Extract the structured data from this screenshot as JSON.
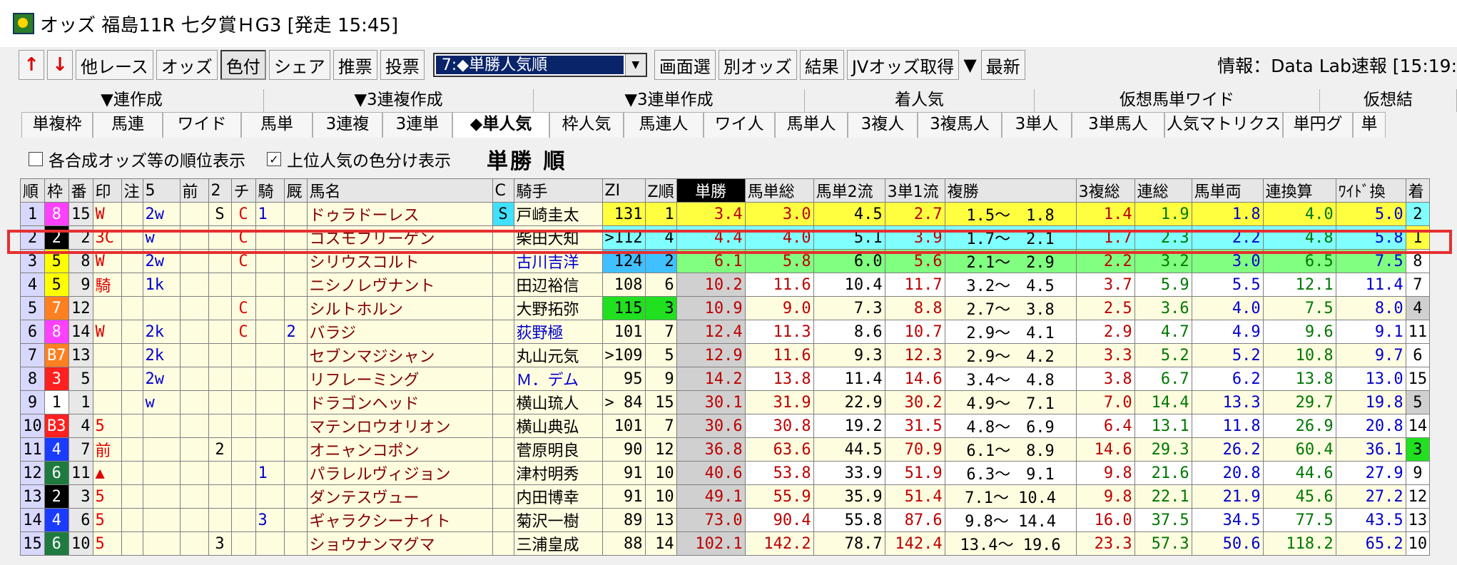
{
  "window": {
    "title": "オッズ 福島11R 七夕賞ＨG3 [発走 15:45]"
  },
  "toolbar": {
    "up_label": "↑",
    "down_label": "↓",
    "buttons": [
      "他レース",
      "オッズ",
      "色付",
      "シェア",
      "推票",
      "投票"
    ],
    "select_value": "7:◆単勝人気順",
    "buttons2": [
      "画面選",
      "別オッズ",
      "結果",
      "JVオッズ取得",
      "▼",
      "最新"
    ],
    "info": "情報：Data Lab速報 [15:19:"
  },
  "tabs_row1": [
    "▼連作成",
    "▼3連複作成",
    "▼3連単作成",
    "着人気",
    "仮想馬単ワイド",
    "仮想結"
  ],
  "tabs_row2": [
    "単複枠",
    "馬連",
    "ワイド",
    "馬単",
    "3連複",
    "3連単",
    "◆単人気",
    "枠人気",
    "馬連人",
    "ワイ人",
    "馬単人",
    "3複人",
    "3複馬人",
    "3単人",
    "3単馬人",
    "人気マトリクス",
    "単円グ",
    "単"
  ],
  "options": {
    "opt1": "各合成オッズ等の順位表示",
    "opt2": "上位人気の色分け表示",
    "heading": "単勝 順",
    "opt2_check": "✓"
  },
  "table": {
    "headers": [
      "順",
      "枠",
      "番",
      "印",
      "注",
      "5",
      "前",
      "2",
      "チ",
      "騎",
      "厩",
      "馬名",
      "C",
      "騎手",
      "ZI",
      "Z順",
      "単勝",
      "馬単総",
      "馬単2流",
      "3単1流",
      "複勝",
      "3複総",
      "連総",
      "馬単両",
      "連換算",
      "ﾜｲﾄﾞ換",
      "着"
    ],
    "rows": [
      [
        "1",
        "8",
        "15",
        "W",
        "",
        "2w",
        "",
        "S",
        "C",
        "1",
        "",
        "ドゥラドーレス",
        "S",
        "戸崎圭太",
        "131",
        "1",
        "3.4",
        "3.0",
        "4.5",
        "2.7",
        "1.5〜　1.8",
        "1.4",
        "1.9",
        "1.8",
        "4.0",
        "5.0",
        "2"
      ],
      [
        "2",
        "2",
        "2",
        "3C",
        "",
        "w",
        "",
        "",
        "C",
        "",
        "",
        "コスモフリーゲン",
        "",
        "柴田大知",
        ">112",
        "4",
        "4.4",
        "4.0",
        "5.1",
        "3.9",
        "1.7〜　2.1",
        "1.7",
        "2.3",
        "2.2",
        "4.8",
        "5.8",
        "1"
      ],
      [
        "3",
        "5",
        "8",
        "W",
        "",
        "2w",
        "",
        "",
        "C",
        "",
        "",
        "シリウスコルト",
        "",
        "古川吉洋",
        "124",
        "2",
        "6.1",
        "5.8",
        "6.0",
        "5.6",
        "2.1〜　2.9",
        "2.2",
        "3.2",
        "3.0",
        "6.5",
        "7.5",
        "8"
      ],
      [
        "4",
        "5",
        "9",
        "騎",
        "",
        "1k",
        "",
        "",
        "",
        "",
        "",
        "ニシノレヴナント",
        "",
        "田辺裕信",
        "108",
        "6",
        "10.2",
        "11.6",
        "10.4",
        "11.7",
        "3.2〜　4.5",
        "3.7",
        "5.9",
        "5.5",
        "12.1",
        "11.4",
        "7"
      ],
      [
        "5",
        "7",
        "12",
        "",
        "",
        "",
        "",
        "",
        "C",
        "",
        "",
        "シルトホルン",
        "",
        "大野拓弥",
        "115",
        "3",
        "10.9",
        "9.0",
        "7.3",
        "8.8",
        "2.7〜　3.8",
        "2.5",
        "3.6",
        "4.0",
        "7.5",
        "8.0",
        "4"
      ],
      [
        "6",
        "8",
        "14",
        "W",
        "",
        "2k",
        "",
        "",
        "C",
        "",
        "2",
        "バラジ",
        "",
        "荻野極",
        "101",
        "7",
        "12.4",
        "11.3",
        "8.6",
        "10.7",
        "2.9〜　4.1",
        "2.9",
        "4.7",
        "4.9",
        "9.6",
        "9.1",
        "11"
      ],
      [
        "7",
        "B7",
        "13",
        "",
        "",
        "2k",
        "",
        "",
        "",
        "",
        "",
        "セブンマジシャン",
        "",
        "丸山元気",
        ">109",
        "5",
        "12.9",
        "11.6",
        "9.3",
        "12.3",
        "2.9〜　4.2",
        "3.3",
        "5.2",
        "5.2",
        "10.8",
        "9.7",
        "6"
      ],
      [
        "8",
        "3",
        "5",
        "",
        "",
        "2w",
        "",
        "",
        "",
        "",
        "",
        "リフレーミング",
        "",
        "Ｍ．デム",
        "95",
        "9",
        "14.2",
        "13.8",
        "11.4",
        "14.6",
        "3.4〜　4.8",
        "3.8",
        "6.7",
        "6.2",
        "13.8",
        "13.0",
        "15"
      ],
      [
        "9",
        "1",
        "1",
        "",
        "",
        "w",
        "",
        "",
        "",
        "",
        "",
        "ドラゴンヘッド",
        "",
        "横山琉人",
        "> 84",
        "15",
        "30.1",
        "31.9",
        "22.9",
        "30.2",
        "4.9〜　7.1",
        "7.0",
        "14.4",
        "13.3",
        "29.7",
        "19.8",
        "5"
      ],
      [
        "10",
        "B3",
        "4",
        "5",
        "",
        "",
        "",
        "",
        "",
        "",
        "",
        "マテンロウオリオン",
        "",
        "横山典弘",
        "101",
        "7",
        "30.6",
        "30.8",
        "19.2",
        "31.5",
        "4.8〜　6.9",
        "6.4",
        "13.1",
        "11.8",
        "26.9",
        "20.8",
        "14"
      ],
      [
        "11",
        "4",
        "7",
        "前",
        "",
        "",
        "",
        "2",
        "",
        "",
        "",
        "オニャンコポン",
        "",
        "菅原明良",
        "90",
        "12",
        "36.8",
        "63.6",
        "44.5",
        "70.9",
        "6.1〜　8.9",
        "14.6",
        "29.3",
        "26.2",
        "60.4",
        "36.1",
        "3"
      ],
      [
        "12",
        "6",
        "11",
        "▲",
        "",
        "",
        "",
        "",
        "",
        "1",
        "",
        "パラレルヴィジョン",
        "",
        "津村明秀",
        "91",
        "10",
        "40.6",
        "53.8",
        "33.9",
        "51.9",
        "6.3〜　9.1",
        "9.8",
        "21.6",
        "20.8",
        "44.6",
        "27.9",
        "9"
      ],
      [
        "13",
        "2",
        "3",
        "5",
        "",
        "",
        "",
        "",
        "",
        "",
        "",
        "ダンテスヴュー",
        "",
        "内田博幸",
        "91",
        "10",
        "49.1",
        "55.9",
        "35.9",
        "51.4",
        "7.1〜 10.4",
        "9.8",
        "22.1",
        "21.9",
        "45.6",
        "27.2",
        "12"
      ],
      [
        "14",
        "4",
        "6",
        "5",
        "",
        "",
        "",
        "",
        "",
        "3",
        "",
        "ギャラクシーナイト",
        "",
        "菊沢一樹",
        "89",
        "13",
        "73.0",
        "90.4",
        "55.8",
        "87.6",
        "9.8〜 14.4",
        "16.0",
        "37.5",
        "34.5",
        "77.5",
        "43.5",
        "13"
      ],
      [
        "15",
        "6",
        "10",
        "5",
        "",
        "",
        "",
        "3",
        "",
        "",
        "",
        "ショウナンマグマ",
        "",
        "三浦皇成",
        "88",
        "14",
        "102.1",
        "142.2",
        "78.7",
        "142.4",
        "13.4〜 19.6",
        "23.3",
        "57.3",
        "50.6",
        "118.2",
        "65.2",
        "10"
      ]
    ]
  },
  "colors": {
    "waku": {
      "1": "#ffffff",
      "2": "#000000",
      "3": "#ff2020",
      "4": "#1a3cff",
      "5": "#ffff00",
      "6": "#1f7a3f",
      "7": "#ff8020",
      "8": "#ff40ff",
      "B3": "#ff2020",
      "B7": "#ff8020"
    },
    "rank1": "#ffff40",
    "rank2": "#80ffff",
    "rank3": "#80ff80",
    "highlight": "#e53030"
  }
}
